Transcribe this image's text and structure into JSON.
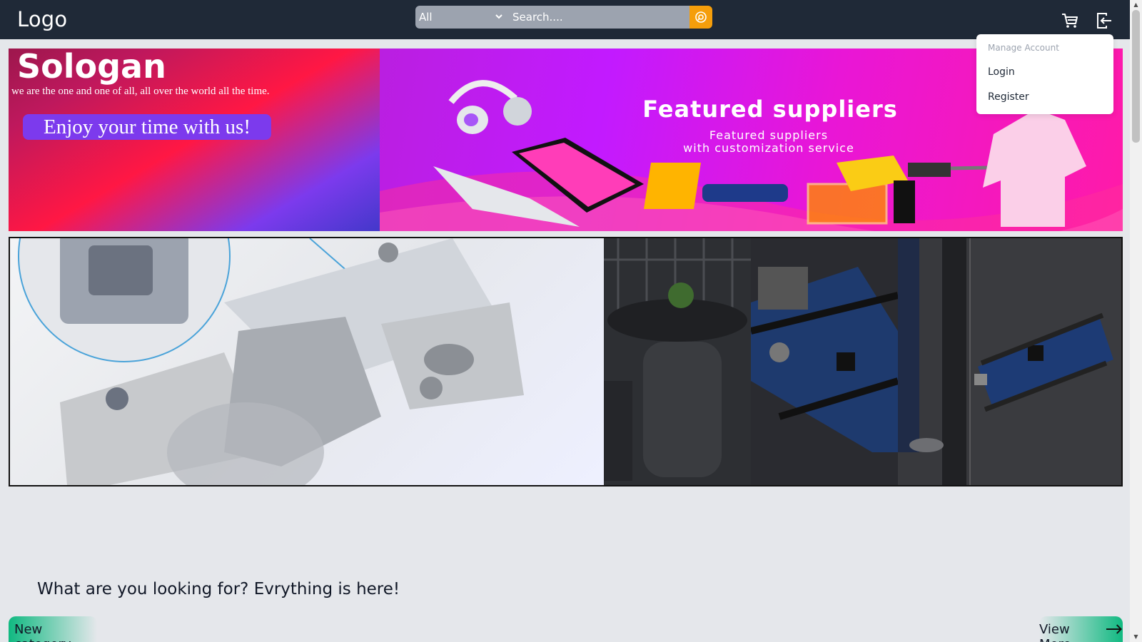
{
  "header": {
    "logo": "Logo",
    "search": {
      "category_selected": "All",
      "placeholder": "Search...."
    },
    "icons": {
      "search": "search-icon",
      "cart": "cart-icon",
      "logout": "logout-icon"
    }
  },
  "account_menu": {
    "title": "Manage Account",
    "items": [
      "Login",
      "Register"
    ]
  },
  "hero": {
    "slogan": "Sologan",
    "tagline": "we are the one and one of all, all over the world all the time.",
    "cta": "Enjoy your time with us!",
    "banner": {
      "title": "Featured suppliers",
      "subtitle": "Featured suppliers\nwith customization service"
    }
  },
  "gallery": {
    "main_image": "cabinet-hinge",
    "thumbnails": [
      "patio-table-set",
      "arduino-uno-board",
      "legs-product",
      "arduino-nano-board"
    ]
  },
  "section": {
    "heading": "What are you looking for? Evrything is here!",
    "new_category": "New category",
    "view_more": "View More"
  },
  "colors": {
    "navbar": "#1f2937",
    "search_button": "#f59e0b",
    "accent_green": "#10b981",
    "pill_purple": "#7c3aed"
  }
}
